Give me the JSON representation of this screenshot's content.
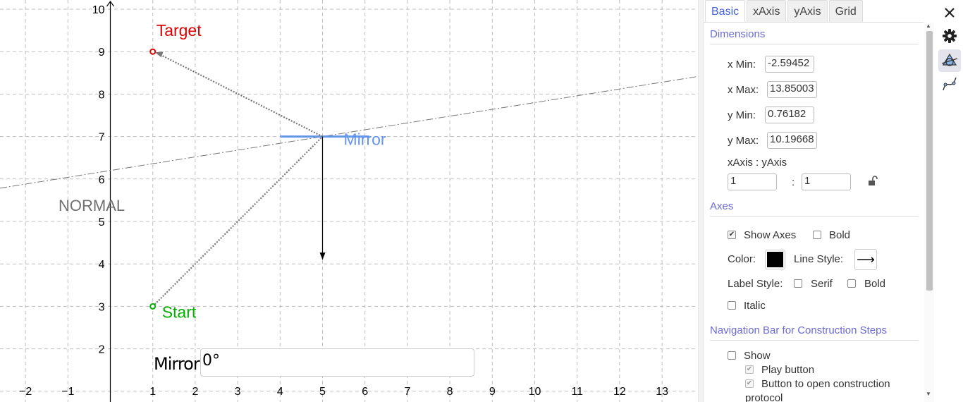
{
  "graphics": {
    "axes": {
      "x_ticks": [
        "−2",
        "−1",
        "1",
        "2",
        "3",
        "4",
        "5",
        "6",
        "7",
        "8",
        "9",
        "10",
        "11",
        "12",
        "13"
      ],
      "y_ticks": [
        "2",
        "3",
        "4",
        "5",
        "6",
        "7",
        "8",
        "9",
        "10"
      ]
    },
    "labels": {
      "target": "Target",
      "start": "Start",
      "mirror": "Mirror",
      "normal": "NORMAL"
    },
    "colors": {
      "target": "#e00000",
      "start": "#00b000",
      "mirror": "#6495ed",
      "normal_text": "#707070",
      "ray": "#777777",
      "grid": "#bfbfbf"
    },
    "points": {
      "target": [
        1,
        9
      ],
      "start": [
        1,
        3
      ],
      "mirror_hit": [
        5,
        7
      ],
      "normal_end": [
        5,
        4.1
      ]
    },
    "mirror_input": {
      "label": "Mirror",
      "value": "0°"
    }
  },
  "panel": {
    "tabs": [
      "Basic",
      "xAxis",
      "yAxis",
      "Grid"
    ],
    "active_tab": "Basic",
    "dimensions": {
      "title": "Dimensions",
      "x_min_label": "x Min:",
      "x_min": "-2.59452",
      "x_max_label": "x Max:",
      "x_max": "13.85003",
      "y_min_label": "y Min:",
      "y_min": "0.76182",
      "y_max_label": "y Max:",
      "y_max": "10.19668",
      "ratio_label": "xAxis : yAxis",
      "ratio_x": "1",
      "ratio_sep": ":",
      "ratio_y": "1"
    },
    "axes": {
      "title": "Axes",
      "show_axes": "Show Axes",
      "bold": "Bold",
      "color_label": "Color:",
      "color_value": "#000000",
      "line_style_label": "Line Style:",
      "line_style_glyph": "⟶",
      "label_style": "Label Style:",
      "serif": "Serif",
      "bold2": "Bold",
      "italic": "Italic"
    },
    "navigation": {
      "title": "Navigation Bar for Construction Steps",
      "show": "Show",
      "play_button": "Play button",
      "open_protocol": "Button to open construction",
      "open_protocol_cont": "protocol"
    }
  },
  "sidebar": {
    "icons": [
      "close-icon",
      "gear-icon",
      "graphics-view-icon",
      "algebra-curve-icon"
    ]
  }
}
